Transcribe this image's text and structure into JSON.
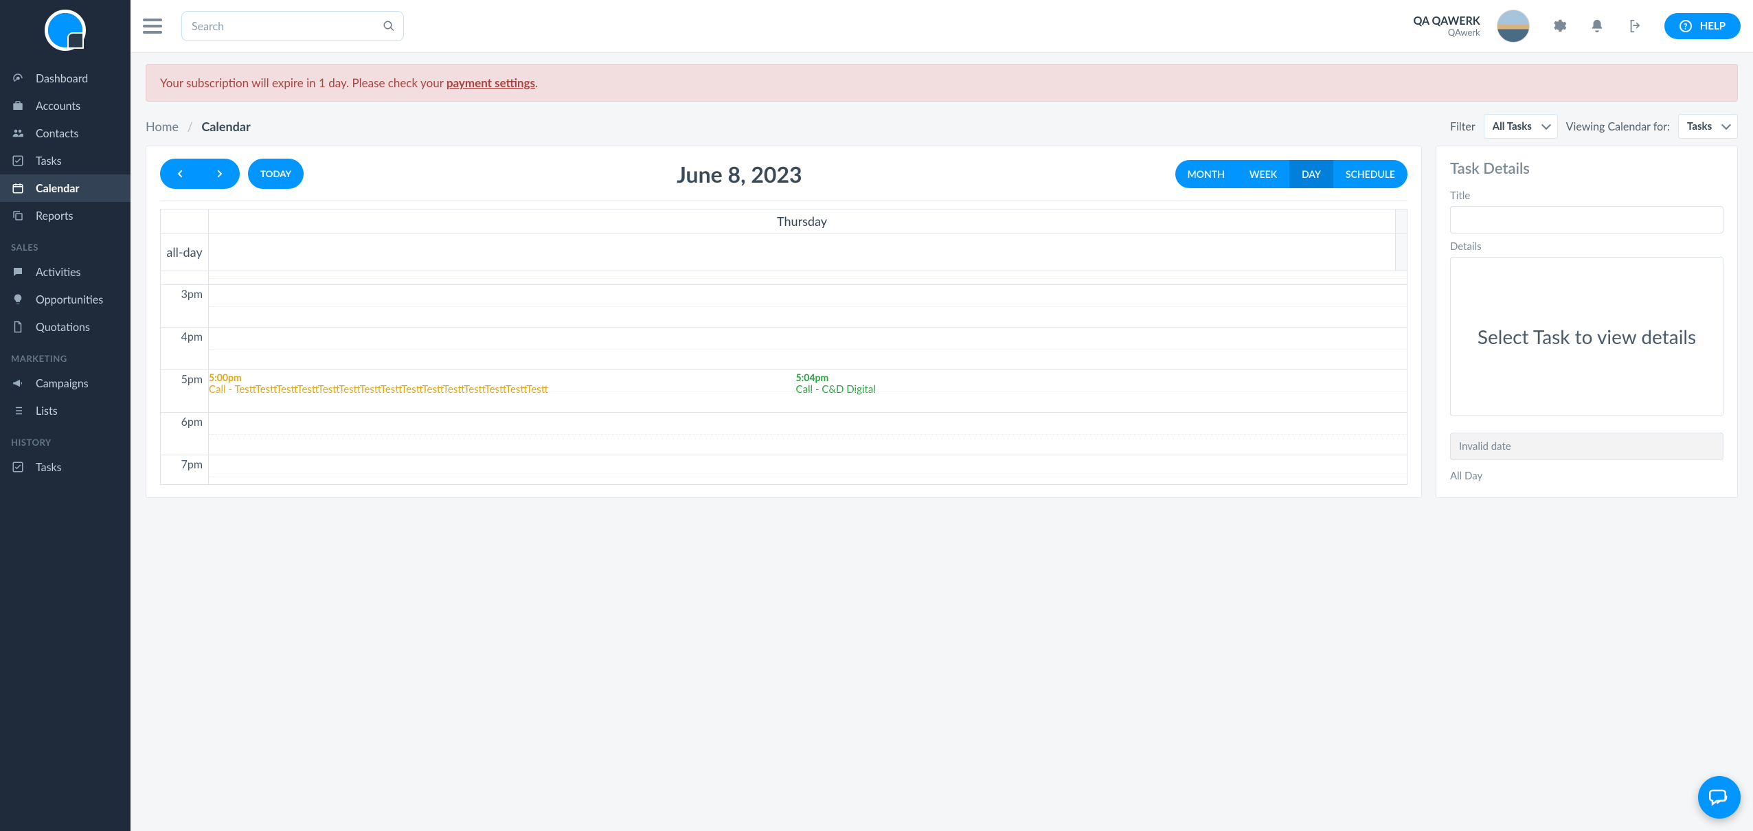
{
  "topbar": {
    "search_placeholder": "Search",
    "user_name": "QA QAWERK",
    "user_org": "QAwerk",
    "help_label": "HELP"
  },
  "sidebar": {
    "items_main": [
      {
        "label": "Dashboard",
        "icon": "gauge"
      },
      {
        "label": "Accounts",
        "icon": "briefcase"
      },
      {
        "label": "Contacts",
        "icon": "users"
      },
      {
        "label": "Tasks",
        "icon": "check"
      },
      {
        "label": "Calendar",
        "icon": "calendar",
        "active": true
      },
      {
        "label": "Reports",
        "icon": "copy"
      }
    ],
    "section_sales": "SALES",
    "items_sales": [
      {
        "label": "Activities",
        "icon": "chat"
      },
      {
        "label": "Opportunities",
        "icon": "bulb"
      },
      {
        "label": "Quotations",
        "icon": "file"
      }
    ],
    "section_marketing": "MARKETING",
    "items_marketing": [
      {
        "label": "Campaigns",
        "icon": "megaphone"
      },
      {
        "label": "Lists",
        "icon": "list"
      }
    ],
    "section_history": "HISTORY",
    "items_history": [
      {
        "label": "Tasks",
        "icon": "check"
      }
    ]
  },
  "alert": {
    "text_before": "Your subscription will expire in 1 day. Please check your ",
    "link": "payment settings",
    "text_after": "."
  },
  "breadcrumb": {
    "home": "Home",
    "current": "Calendar"
  },
  "filters": {
    "filter_label": "Filter",
    "filter_value": "All Tasks",
    "viewing_label": "Viewing Calendar for:",
    "viewing_value": "Tasks"
  },
  "calendar": {
    "today_label": "TODAY",
    "title": "June 8, 2023",
    "views": [
      "MONTH",
      "WEEK",
      "DAY",
      "SCHEDULE"
    ],
    "active_view": "DAY",
    "day_header": "Thursday",
    "allday_label": "all-day",
    "hours": [
      "3pm",
      "4pm",
      "5pm",
      "6pm",
      "7pm"
    ],
    "events": [
      {
        "time": "5:00pm",
        "title": "Call - TesttTesttTesttTesttTesttTesttTesttTesttTesttTesttTesttTesttTesttTesttTestt",
        "color": "orange",
        "hour_index": 2,
        "left_pct": 0
      },
      {
        "time": "5:04pm",
        "title": "Call - C&D Digital",
        "color": "green",
        "hour_index": 2,
        "left_pct": 49
      }
    ]
  },
  "details": {
    "panel_title": "Task Details",
    "title_label": "Title",
    "details_label": "Details",
    "placeholder_message": "Select Task to view details",
    "date_value": "Invalid date",
    "allday_label": "All Day"
  }
}
